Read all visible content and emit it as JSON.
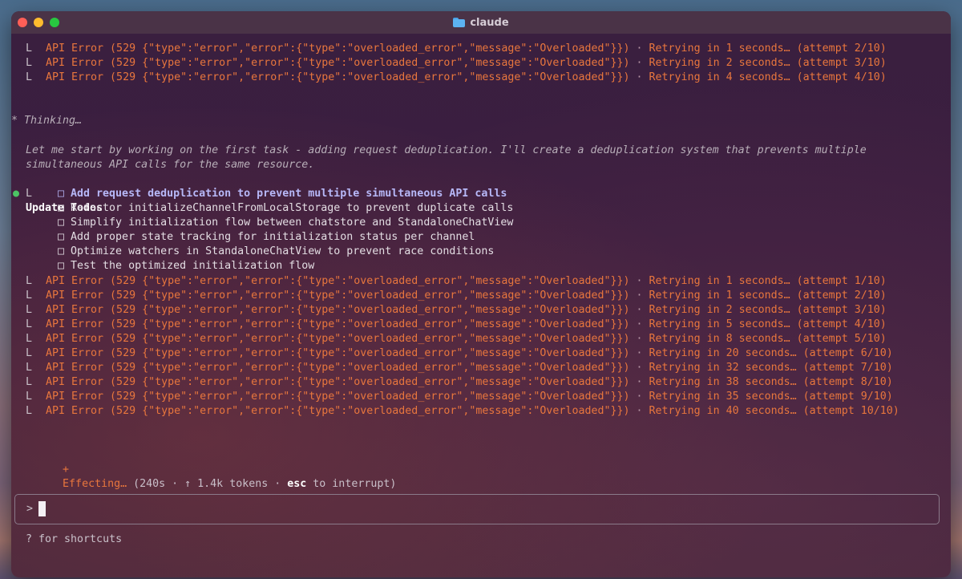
{
  "window": {
    "title": "claude",
    "folder_icon": "folder-icon"
  },
  "log_top": [
    {
      "gutter": "L",
      "message": "API Error (529 {\"type\":\"error\",\"error\":{\"type\":\"overloaded_error\",\"message\":\"Overloaded\"}})",
      "sep": " · ",
      "retry": "Retrying in 1 seconds… (attempt 2/10)"
    },
    {
      "gutter": "L",
      "message": "API Error (529 {\"type\":\"error\",\"error\":{\"type\":\"overloaded_error\",\"message\":\"Overloaded\"}})",
      "sep": " · ",
      "retry": "Retrying in 2 seconds… (attempt 3/10)"
    },
    {
      "gutter": "L",
      "message": "API Error (529 {\"type\":\"error\",\"error\":{\"type\":\"overloaded_error\",\"message\":\"Overloaded\"}})",
      "sep": " · ",
      "retry": "Retrying in 4 seconds… (attempt 4/10)"
    }
  ],
  "thinking": {
    "label": "* Thinking…",
    "lines": [
      "Let me start by working on the first task - adding request deduplication. I'll create a deduplication system that prevents multiple",
      "simultaneous API calls for the same resource."
    ]
  },
  "todos": {
    "bullet": "●",
    "heading": "Update Todos",
    "gutter": "L",
    "box": "□",
    "items": [
      "Add request deduplication to prevent multiple simultaneous API calls",
      "Refactor initializeChannelFromLocalStorage to prevent duplicate calls",
      "Simplify initialization flow between chatstore and StandaloneChatView",
      "Add proper state tracking for initialization status per channel",
      "Optimize watchers in StandaloneChatView to prevent race conditions",
      "Test the optimized initialization flow"
    ]
  },
  "log_bottom": [
    {
      "gutter": "L",
      "message": "API Error (529 {\"type\":\"error\",\"error\":{\"type\":\"overloaded_error\",\"message\":\"Overloaded\"}})",
      "sep": " · ",
      "retry": "Retrying in 1 seconds… (attempt 1/10)"
    },
    {
      "gutter": "L",
      "message": "API Error (529 {\"type\":\"error\",\"error\":{\"type\":\"overloaded_error\",\"message\":\"Overloaded\"}})",
      "sep": " · ",
      "retry": "Retrying in 1 seconds… (attempt 2/10)"
    },
    {
      "gutter": "L",
      "message": "API Error (529 {\"type\":\"error\",\"error\":{\"type\":\"overloaded_error\",\"message\":\"Overloaded\"}})",
      "sep": " · ",
      "retry": "Retrying in 2 seconds… (attempt 3/10)"
    },
    {
      "gutter": "L",
      "message": "API Error (529 {\"type\":\"error\",\"error\":{\"type\":\"overloaded_error\",\"message\":\"Overloaded\"}})",
      "sep": " · ",
      "retry": "Retrying in 5 seconds… (attempt 4/10)"
    },
    {
      "gutter": "L",
      "message": "API Error (529 {\"type\":\"error\",\"error\":{\"type\":\"overloaded_error\",\"message\":\"Overloaded\"}})",
      "sep": " · ",
      "retry": "Retrying in 8 seconds… (attempt 5/10)"
    },
    {
      "gutter": "L",
      "message": "API Error (529 {\"type\":\"error\",\"error\":{\"type\":\"overloaded_error\",\"message\":\"Overloaded\"}})",
      "sep": " · ",
      "retry": "Retrying in 20 seconds… (attempt 6/10)"
    },
    {
      "gutter": "L",
      "message": "API Error (529 {\"type\":\"error\",\"error\":{\"type\":\"overloaded_error\",\"message\":\"Overloaded\"}})",
      "sep": " · ",
      "retry": "Retrying in 32 seconds… (attempt 7/10)"
    },
    {
      "gutter": "L",
      "message": "API Error (529 {\"type\":\"error\",\"error\":{\"type\":\"overloaded_error\",\"message\":\"Overloaded\"}})",
      "sep": " · ",
      "retry": "Retrying in 38 seconds… (attempt 8/10)"
    },
    {
      "gutter": "L",
      "message": "API Error (529 {\"type\":\"error\",\"error\":{\"type\":\"overloaded_error\",\"message\":\"Overloaded\"}})",
      "sep": " · ",
      "retry": "Retrying in 35 seconds… (attempt 9/10)"
    },
    {
      "gutter": "L",
      "message": "API Error (529 {\"type\":\"error\",\"error\":{\"type\":\"overloaded_error\",\"message\":\"Overloaded\"}})",
      "sep": " · ",
      "retry": "Retrying in 40 seconds… (attempt 10/10)"
    }
  ],
  "status": {
    "spinner": "+",
    "label": "Effecting…",
    "detail_open": " (240s · ↑ 1.4k tokens · ",
    "key": "esc",
    "detail_close": " to interrupt)"
  },
  "input": {
    "prompt": ">",
    "value": ""
  },
  "footer": {
    "hint": "? for shortcuts"
  },
  "colors": {
    "error": "#e8763d",
    "active_todo": "#b7b8f8",
    "bullet": "#4cc464",
    "close": "#ff5f57",
    "minimize": "#febc2e",
    "zoom": "#28c840"
  }
}
